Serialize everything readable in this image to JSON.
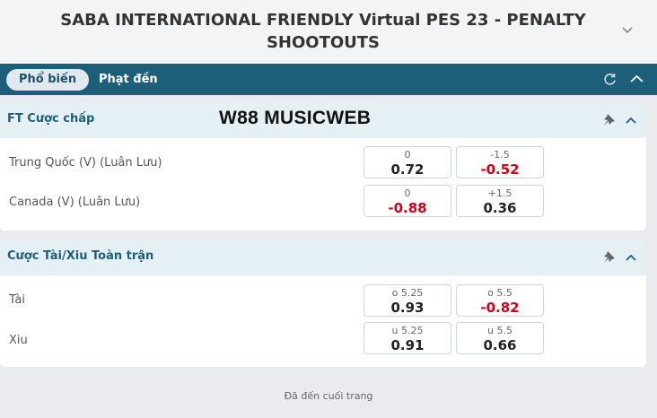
{
  "header": {
    "title": "SABA INTERNATIONAL FRIENDLY Virtual PES 23 - PENALTY SHOOTOUTS"
  },
  "tabs": [
    {
      "label": "Phổ biến",
      "active": true
    },
    {
      "label": "Phạt đền",
      "active": false
    }
  ],
  "tabbar_icons": [
    "refresh-icon",
    "chevron-up-icon"
  ],
  "watermark": "W88 MUSICWEB",
  "markets": [
    {
      "title": "FT Cược chấp",
      "rows": [
        {
          "name": "Trung Quốc (V) (Luân Lưu)",
          "odds": [
            {
              "line": "0",
              "price": "0.72",
              "negative": false
            },
            {
              "line": "-1.5",
              "price": "-0.52",
              "negative": true
            }
          ]
        },
        {
          "name": "Canada (V) (Luân Lưu)",
          "odds": [
            {
              "line": "0",
              "price": "-0.88",
              "negative": true
            },
            {
              "line": "+1.5",
              "price": "0.36",
              "negative": false
            }
          ]
        }
      ]
    },
    {
      "title": "Cược Tài/Xiu Toàn trận",
      "rows": [
        {
          "name": "Tài",
          "odds": [
            {
              "line": "o 5.25",
              "price": "0.93",
              "negative": false
            },
            {
              "line": "o 5.5",
              "price": "-0.82",
              "negative": true
            }
          ]
        },
        {
          "name": "Xiu",
          "odds": [
            {
              "line": "u 5.25",
              "price": "0.91",
              "negative": false
            },
            {
              "line": "u 5.5",
              "price": "0.66",
              "negative": false
            }
          ]
        }
      ]
    }
  ],
  "footer": {
    "text": "Đã đến cuối trang"
  },
  "colors": {
    "tabbar": "#1d5f79",
    "negative_price": "#d0021b",
    "section_header": "#e5f0f5"
  }
}
